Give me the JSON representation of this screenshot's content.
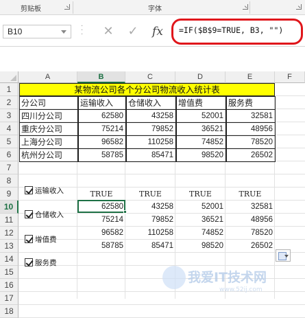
{
  "ribbon": {
    "clipboard_label": "剪贴板",
    "font_label": "字体"
  },
  "formula_bar": {
    "name_box": "B10",
    "cancel_symbol": "✕",
    "enter_symbol": "✓",
    "fx_label": "fx",
    "formula": "=IF($B$9=TRUE, B3, \"\")",
    "highlight_color": "#e0161b"
  },
  "columns": [
    "A",
    "B",
    "C",
    "D",
    "E",
    "F"
  ],
  "rows": [
    "1",
    "2",
    "3",
    "4",
    "5",
    "6",
    "7",
    "8",
    "9",
    "10",
    "11",
    "12",
    "13",
    "14",
    "15",
    "16",
    "17",
    "18"
  ],
  "selected_column": "B",
  "selected_row": "10",
  "table": {
    "title": "某物流公司各个分公司物流收入统计表",
    "title_fill": "#ffff00",
    "headers": [
      "分公司",
      "运输收入",
      "仓储收入",
      "增值费",
      "服务费"
    ],
    "rows": [
      [
        "四川分公司",
        "62580",
        "43258",
        "52001",
        "32581"
      ],
      [
        "重庆分公司",
        "75214",
        "79852",
        "36521",
        "48956"
      ],
      [
        "上海分公司",
        "96582",
        "110258",
        "74852",
        "78520"
      ],
      [
        "杭州分公司",
        "58785",
        "85471",
        "98520",
        "26502"
      ]
    ]
  },
  "checkboxes": [
    {
      "label": "运输收入",
      "checked": true
    },
    {
      "label": "仓储收入",
      "checked": true
    },
    {
      "label": "增值费",
      "checked": true
    },
    {
      "label": "服务费",
      "checked": true
    }
  ],
  "result": {
    "flags": [
      "TRUE",
      "TRUE",
      "TRUE",
      "TRUE"
    ],
    "rows": [
      [
        "62580",
        "43258",
        "52001",
        "32581"
      ],
      [
        "75214",
        "79852",
        "36521",
        "48956"
      ],
      [
        "96582",
        "110258",
        "74852",
        "78520"
      ],
      [
        "58785",
        "85471",
        "98520",
        "26502"
      ]
    ]
  },
  "accent_color": "#1e7145",
  "watermark": {
    "text": "我爱IT技术网",
    "url": "www.52ij.com"
  }
}
